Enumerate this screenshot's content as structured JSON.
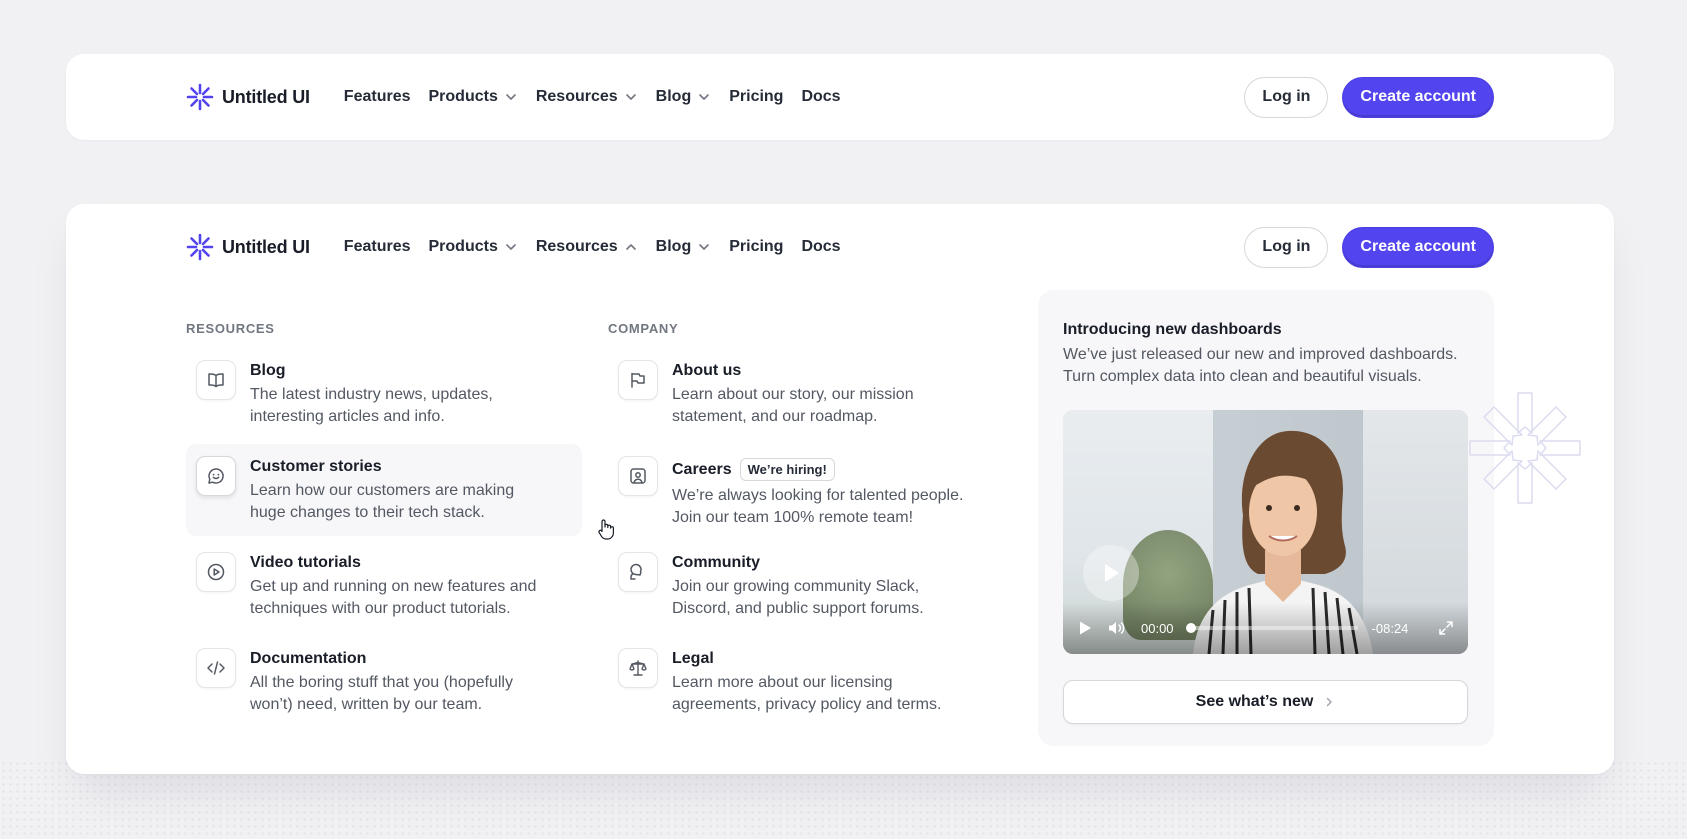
{
  "brand": {
    "name": "Untitled UI",
    "accent": "#5244ef"
  },
  "nav": {
    "items": [
      {
        "label": "Features",
        "has_chevron": false
      },
      {
        "label": "Products",
        "has_chevron": true
      },
      {
        "label": "Resources",
        "has_chevron": true
      },
      {
        "label": "Blog",
        "has_chevron": true
      },
      {
        "label": "Pricing",
        "has_chevron": false
      },
      {
        "label": "Docs",
        "has_chevron": false
      }
    ],
    "login_label": "Log in",
    "create_label": "Create account"
  },
  "dropdown": {
    "resources": {
      "heading": "RESOURCES",
      "items": [
        {
          "icon": "book-open-icon",
          "title": "Blog",
          "desc": "The latest industry news, updates, interesting articles and info."
        },
        {
          "icon": "message-smile-icon",
          "title": "Customer stories",
          "desc": "Learn how our customers are making huge changes to their tech stack."
        },
        {
          "icon": "play-circle-icon",
          "title": "Video tutorials",
          "desc": "Get up and running on new features and techniques with our product tutorials."
        },
        {
          "icon": "code-icon",
          "title": "Documentation",
          "desc": "All the boring stuff that you (hopefully won’t) need, written by our team."
        }
      ]
    },
    "company": {
      "heading": "COMPANY",
      "items": [
        {
          "icon": "flag-icon",
          "title": "About us",
          "desc": "Learn about our story, our mission statement, and our roadmap."
        },
        {
          "icon": "image-user-icon",
          "title": "Careers",
          "badge": "We’re hiring!",
          "desc": "We’re always looking for talented people. Join our team 100% remote team!"
        },
        {
          "icon": "chat-bubbles-icon",
          "title": "Community",
          "desc": "Join our growing community Slack, Discord, and public support forums."
        },
        {
          "icon": "scales-icon",
          "title": "Legal",
          "desc": "Learn more about our licensing agreements, privacy policy and terms."
        }
      ]
    },
    "feature": {
      "title": "Introducing new dashboards",
      "desc": "We’ve just released our new and improved dashboards. Turn complex data into clean and beautiful visuals.",
      "video": {
        "current_time": "00:00",
        "remaining_time": "-08:24",
        "progress": 0.02
      },
      "cta_label": "See what’s new"
    }
  }
}
